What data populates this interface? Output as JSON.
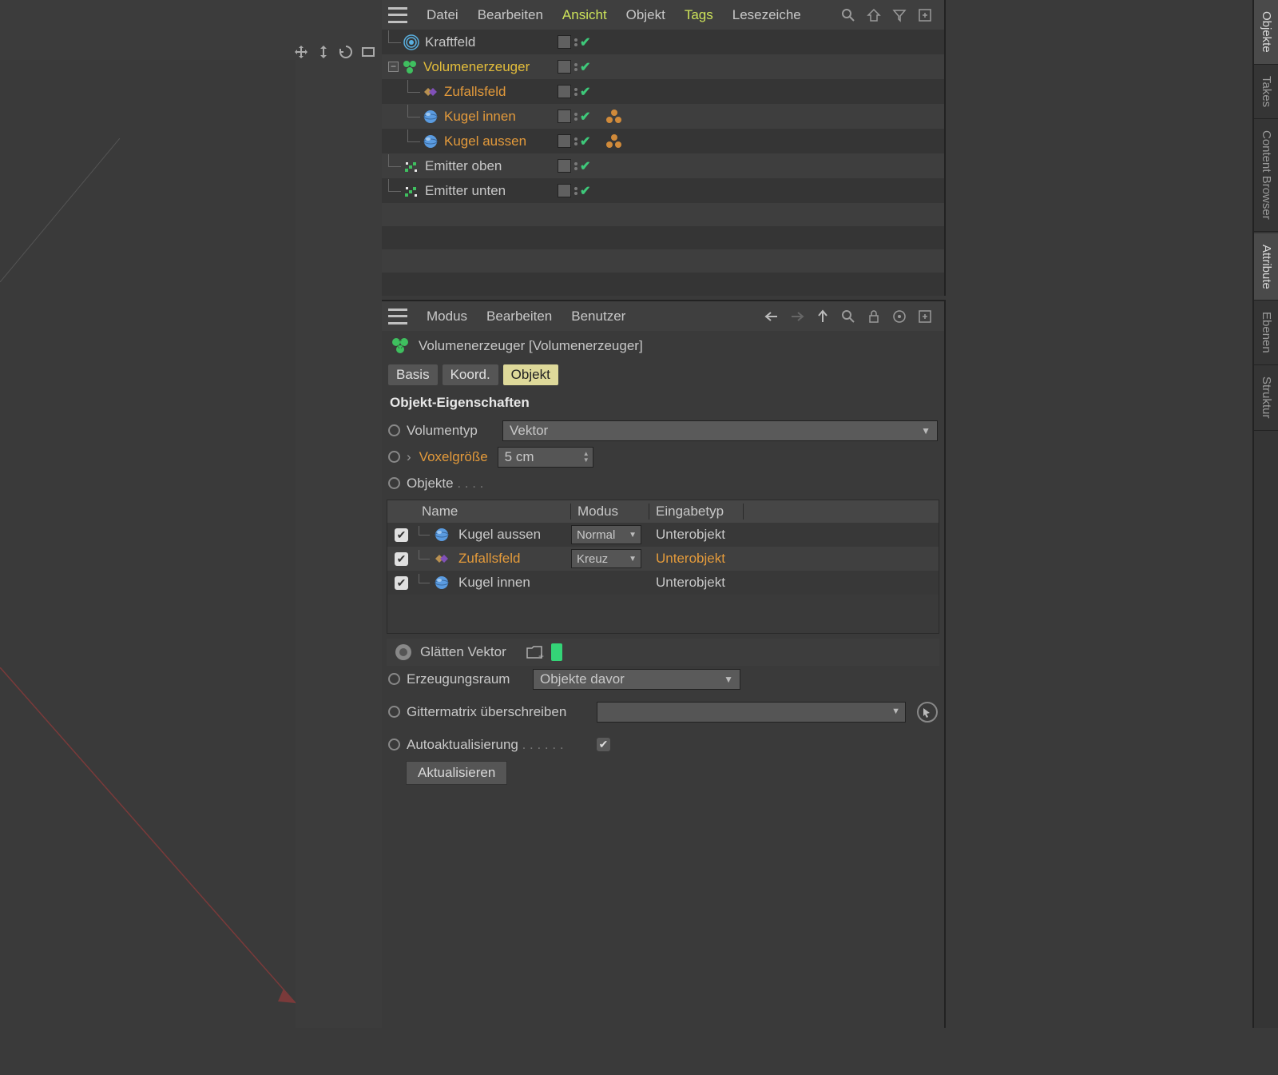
{
  "objectManager": {
    "menu": {
      "file": "Datei",
      "edit": "Bearbeiten",
      "view": "Ansicht",
      "object": "Objekt",
      "tags": "Tags",
      "bookmarks": "Lesezeiche"
    },
    "tree": [
      {
        "name": "Kraftfeld",
        "icon": "forcefield",
        "color": "normal",
        "depth": 0
      },
      {
        "name": "Volumenerzeuger",
        "icon": "volume-builder",
        "color": "yellow",
        "depth": 0,
        "expanded": true
      },
      {
        "name": "Zufallsfeld",
        "icon": "random-field",
        "color": "orange",
        "depth": 1
      },
      {
        "name": "Kugel innen",
        "icon": "sphere",
        "color": "orange",
        "depth": 1,
        "extraTag": true
      },
      {
        "name": "Kugel aussen",
        "icon": "sphere",
        "color": "orange",
        "depth": 1,
        "extraTag": true
      },
      {
        "name": "Emitter oben",
        "icon": "emitter",
        "color": "normal",
        "depth": 0
      },
      {
        "name": "Emitter unten",
        "icon": "emitter",
        "color": "normal",
        "depth": 0
      }
    ]
  },
  "attributeManager": {
    "menu": {
      "mode": "Modus",
      "edit": "Bearbeiten",
      "user": "Benutzer"
    },
    "title": "Volumenerzeuger [Volumenerzeuger]",
    "tabs": {
      "basis": "Basis",
      "coord": "Koord.",
      "object": "Objekt"
    },
    "section": "Objekt-Eigenschaften",
    "props": {
      "volumeType": {
        "label": "Volumentyp",
        "value": "Vektor"
      },
      "voxelSize": {
        "label": "Voxelgröße",
        "value": "5 cm"
      },
      "objects": {
        "label": "Objekte"
      },
      "table": {
        "headers": {
          "name": "Name",
          "mode": "Modus",
          "inputType": "Eingabetyp"
        },
        "rows": [
          {
            "name": "Kugel aussen",
            "icon": "sphere",
            "mode": "Normal",
            "type": "Unterobjekt",
            "highlighted": false
          },
          {
            "name": "Zufallsfeld",
            "icon": "random-field",
            "mode": "Kreuz",
            "type": "Unterobjekt",
            "highlighted": true
          },
          {
            "name": "Kugel innen",
            "icon": "sphere",
            "mode": "",
            "type": "Unterobjekt",
            "highlighted": false
          }
        ]
      },
      "smoothVector": "Glätten Vektor",
      "creationSpace": {
        "label": "Erzeugungsraum",
        "value": "Objekte davor"
      },
      "overrideGrid": {
        "label": "Gittermatrix überschreiben"
      },
      "autoUpdate": {
        "label": "Autoaktualisierung",
        "checked": true
      },
      "updateBtn": "Aktualisieren"
    }
  },
  "sideTabs": {
    "objects": "Objekte",
    "takes": "Takes",
    "contentBrowser": "Content Browser",
    "attribute": "Attribute",
    "layers": "Ebenen",
    "structure": "Struktur"
  }
}
